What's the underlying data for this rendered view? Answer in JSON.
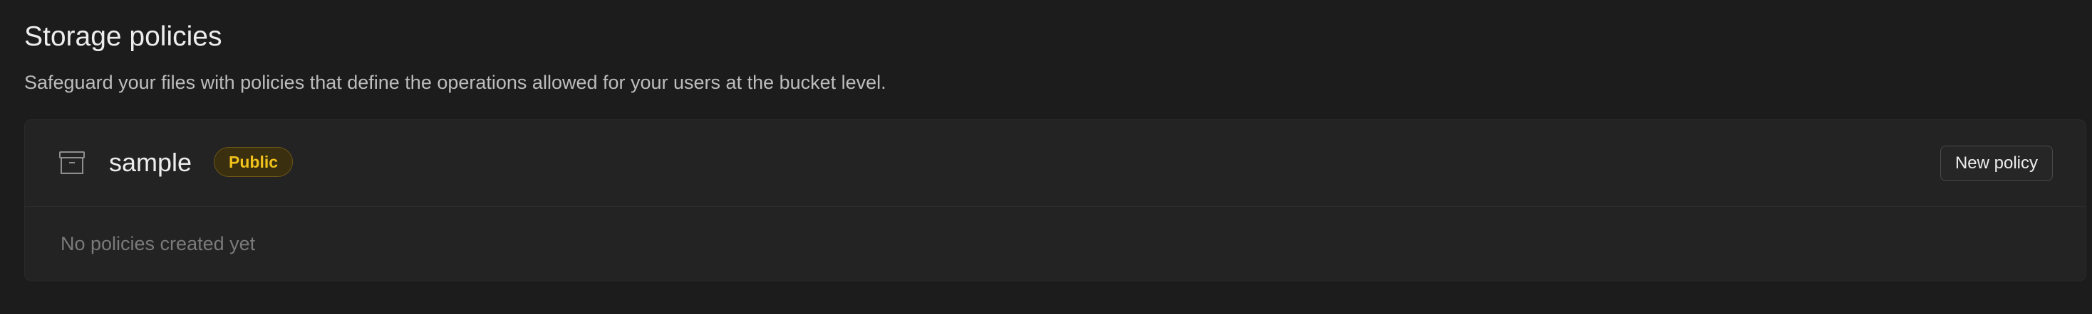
{
  "header": {
    "title": "Storage policies",
    "description": "Safeguard your files with policies that define the operations allowed for your users at the bucket level."
  },
  "bucket": {
    "icon": "archive-box-icon",
    "name": "sample",
    "visibility": "Public",
    "new_policy_label": "New policy",
    "empty_message": "No policies created yet"
  },
  "colors": {
    "background": "#1c1c1c",
    "card": "#232323",
    "badge_text": "#f1c21b",
    "badge_background": "#3a2f0e"
  }
}
